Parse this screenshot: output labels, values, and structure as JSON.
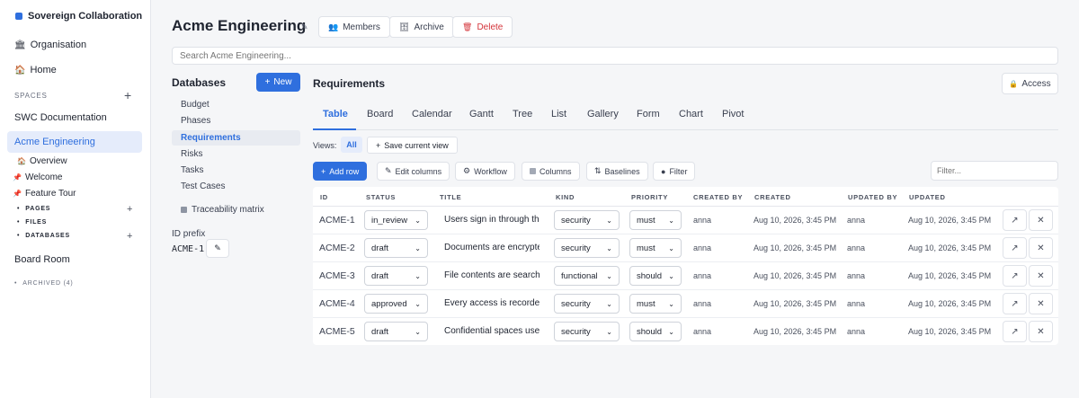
{
  "sidebar": {
    "brand": "Sovereign Collaboration",
    "organisation": "Organisation",
    "home": "Home",
    "spaces_label": "SPACES",
    "spaces": [
      "SWC Documentation",
      "Acme Engineering"
    ],
    "active_space": "Acme Engineering",
    "sub_items": [
      "Overview",
      "Welcome",
      "Feature Tour"
    ],
    "groups": [
      "PAGES",
      "FILES",
      "DATABASES"
    ],
    "board_room": "Board Room",
    "archived": "ARCHIVED (4)"
  },
  "header": {
    "title": "Acme Engineering",
    "members": "Members",
    "archive": "Archive",
    "delete": "Delete",
    "search_placeholder": "Search Acme Engineering..."
  },
  "databases": {
    "title": "Databases",
    "new_label": "New",
    "items": [
      "Budget",
      "Phases",
      "Requirements",
      "Risks",
      "Tasks",
      "Test Cases"
    ],
    "traceability": "Traceability matrix",
    "id_prefix_label": "ID prefix",
    "id_prefix_value": "ACME-1"
  },
  "main": {
    "title": "Requirements",
    "access": "Access",
    "tabs": [
      "Table",
      "Board",
      "Calendar",
      "Gantt",
      "Tree",
      "List",
      "Gallery",
      "Form",
      "Chart",
      "Pivot"
    ],
    "views_label": "Views:",
    "views_all": "All",
    "save_view": "Save current view",
    "toolbar": {
      "add_row": "Add row",
      "edit_columns": "Edit columns",
      "workflow": "Workflow",
      "columns": "Columns",
      "baselines": "Baselines",
      "filter": "Filter",
      "filter_placeholder": "Filter..."
    }
  },
  "table": {
    "headers": [
      "ID",
      "STATUS",
      "TITLE",
      "KIND",
      "PRIORITY",
      "CREATED BY",
      "CREATED",
      "UPDATED BY",
      "UPDATED"
    ],
    "rows": [
      {
        "id": "ACME-1",
        "status": "in_review",
        "title": "Users sign in through the",
        "kind": "security",
        "priority": "must",
        "created_by": "anna",
        "created": "Aug 10, 2026, 3:45 PM",
        "updated_by": "anna",
        "updated": "Aug 10, 2026, 3:45 PM"
      },
      {
        "id": "ACME-2",
        "status": "draft",
        "title": "Documents are encrypted",
        "kind": "security",
        "priority": "must",
        "created_by": "anna",
        "created": "Aug 10, 2026, 3:45 PM",
        "updated_by": "anna",
        "updated": "Aug 10, 2026, 3:45 PM"
      },
      {
        "id": "ACME-3",
        "status": "draft",
        "title": "File contents are searchable",
        "kind": "functional",
        "priority": "should",
        "created_by": "anna",
        "created": "Aug 10, 2026, 3:45 PM",
        "updated_by": "anna",
        "updated": "Aug 10, 2026, 3:45 PM"
      },
      {
        "id": "ACME-4",
        "status": "approved",
        "title": "Every access is recorded",
        "kind": "security",
        "priority": "must",
        "created_by": "anna",
        "created": "Aug 10, 2026, 3:45 PM",
        "updated_by": "anna",
        "updated": "Aug 10, 2026, 3:45 PM"
      },
      {
        "id": "ACME-5",
        "status": "draft",
        "title": "Confidential spaces use",
        "kind": "security",
        "priority": "should",
        "created_by": "anna",
        "created": "Aug 10, 2026, 3:45 PM",
        "updated_by": "anna",
        "updated": "Aug 10, 2026, 3:45 PM"
      }
    ]
  },
  "colors": {
    "accent": "#2f6fde",
    "danger": "#d4343a",
    "active_bg": "#e5ecfb"
  },
  "icons": [
    "organisation-icon",
    "home-icon",
    "overview-icon",
    "pin-icon",
    "members-icon",
    "archive-icon",
    "trash-icon",
    "lock-icon",
    "pencil-icon",
    "expand-icon",
    "close-icon"
  ]
}
